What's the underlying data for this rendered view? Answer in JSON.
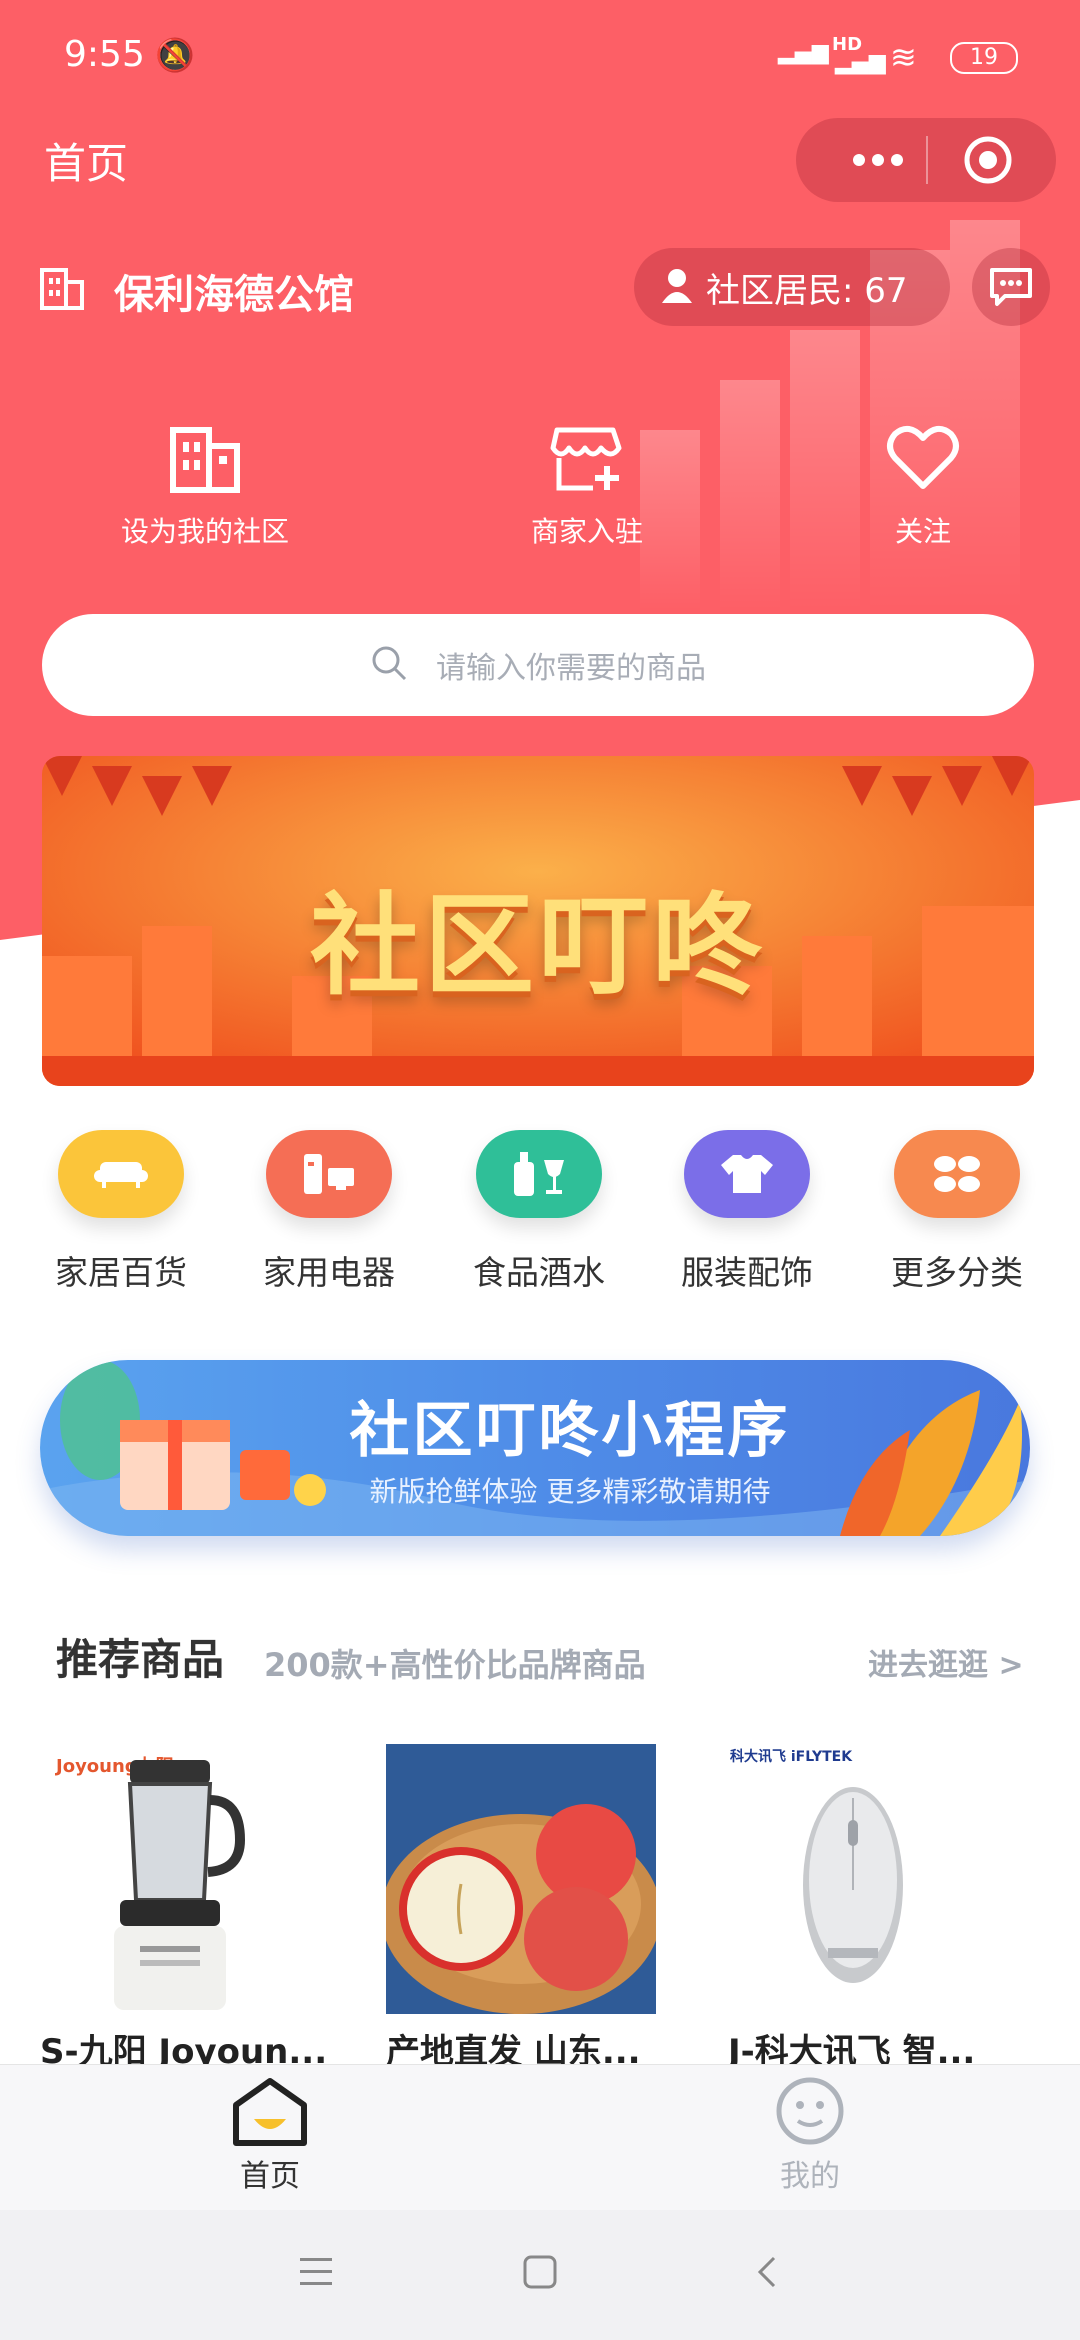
{
  "status_bar": {
    "time": "9:55",
    "network": "HD",
    "battery": "19"
  },
  "nav": {
    "title": "首页",
    "more_icon": "more-dots-icon",
    "target_icon": "target-icon"
  },
  "community": {
    "name": "保利海德公馆",
    "residents_label": "社区居民: 67",
    "building_icon": "building-icon",
    "message_icon": "message-icon"
  },
  "quick_actions": [
    {
      "label": "设为我的社区",
      "icon": "building-icon"
    },
    {
      "label": "商家入驻",
      "icon": "store-icon"
    },
    {
      "label": "关注",
      "icon": "heart-icon"
    }
  ],
  "search": {
    "placeholder": "请输入你需要的商品"
  },
  "banner": {
    "title": "社区叮咚"
  },
  "categories": [
    {
      "label": "家居百货",
      "color": "#fbc53a",
      "icon": "sofa-icon"
    },
    {
      "label": "家用电器",
      "color": "#f56e55",
      "icon": "appliance-icon"
    },
    {
      "label": "食品酒水",
      "color": "#2fbf98",
      "icon": "bottle-icon"
    },
    {
      "label": "服装配饰",
      "color": "#7b6ee8",
      "icon": "shirt-icon"
    },
    {
      "label": "更多分类",
      "color": "#f7894f",
      "icon": "grid-icon"
    }
  ],
  "promo": {
    "title": "社区叮咚小程序",
    "subtitle": "新版抢鲜体验 更多精彩敬请期待"
  },
  "recommend": {
    "title": "推荐商品",
    "subtitle": "200款+高性价比品牌商品",
    "more": "进去逛逛 >",
    "products": [
      {
        "name": "S-九阳 Joyoun...",
        "brand": "Joyoung九阳"
      },
      {
        "name": "产地直发 山东..."
      },
      {
        "name": "J-科大讯飞 智...",
        "brand": "科大讯飞 iFLYTEK"
      }
    ]
  },
  "tabbar": [
    {
      "label": "首页",
      "active": true
    },
    {
      "label": "我的",
      "active": false
    }
  ],
  "colors": {
    "primary": "#fd5f66",
    "text_secondary": "#9aa0aa"
  }
}
